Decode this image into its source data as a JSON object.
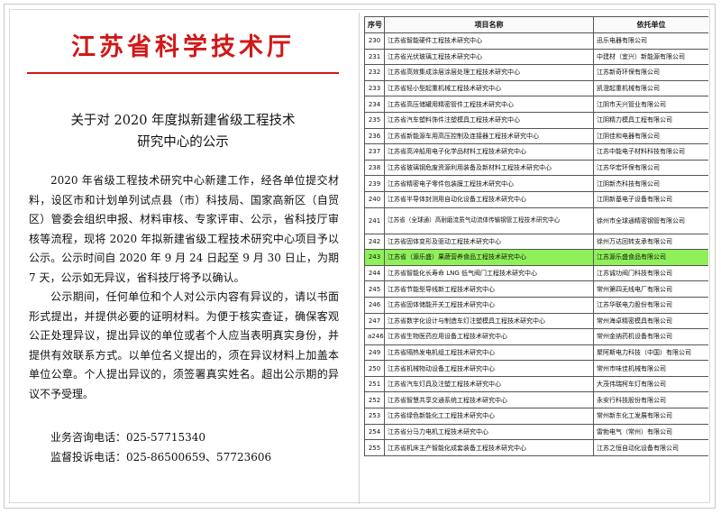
{
  "notice": {
    "masthead": "江苏省科学技术厅",
    "title_line1": "关于对 2020 年度拟新建省级工程技术",
    "title_line2": "研究中心的公示",
    "paragraph1": "2020 年省级工程技术研究中心新建工作，经各单位提交材料，设区市和计划单列试点县（市）科技局、国家高新区（自贸区）管委会组织申报、材料审核、专家评审、公示，省科技厅审核等流程，现将 2020 年拟新建省级工程技术研究中心项目予以公示。公示时间自 2020 年 9 月 24 日起至 9 月 30 日止，为期 7 天，公示如无异议，省科技厅将予以确认。",
    "paragraph2": "公示期间，任何单位和个人对公示内容有异议的，请以书面形式提出，并提供必要的证明材料。为便于核实查证，确保客观公正处理异议，提出异议的单位或者个人应当表明真实身份，并提供有效联系方式。以单位名义提出的，须在异议材料上加盖本单位公章。个人提出异议的，须签署真实姓名。超出公示期的异议不予受理。",
    "consult_label": "业务咨询电话：",
    "consult_phone": "025-57715340",
    "supervise_label": "监督投诉电话：",
    "supervise_phone": "025-86500659、57723606"
  },
  "table": {
    "headers": {
      "no": "序号",
      "name": "项目名称",
      "unit": "依托单位"
    },
    "rows": [
      {
        "no": "230",
        "name": "江苏省智能硬件工程技术研究中心",
        "unit": "迅乐电器有限公司"
      },
      {
        "no": "231",
        "name": "江苏省光伏玻璃工程技术研究中心",
        "unit": "中建材（宜兴）新能源有限公司"
      },
      {
        "no": "232",
        "name": "江苏省高效集成涂层涂层处理工程技术研究中心",
        "unit": "江苏新奇环保有限公司"
      },
      {
        "no": "233",
        "name": "江苏省轻小型起重机械工程技术研究中心",
        "unit": "凯澄起重机械有限公司"
      },
      {
        "no": "234",
        "name": "江苏省高压储罐用精密管件工程技术研究中心",
        "unit": "江阴市天兴管业有限公司"
      },
      {
        "no": "235",
        "name": "江苏省汽车塑料饰件注塑模具工程技术研究中心",
        "unit": "江阴精力模具工程有限公司"
      },
      {
        "no": "236",
        "name": "江苏省新能源车用高压控制及连接器工程技术研究中心",
        "unit": "江阴佳和电器有限公司"
      },
      {
        "no": "237",
        "name": "江苏省高淬船用电子化学品材料工程技术研究中心",
        "unit": "江苏中能电子材料科技有限公司"
      },
      {
        "no": "238",
        "name": "江苏省玻璃钢危废资源利用装备及新材料工程技术研究中心",
        "unit": "江苏华宏环保有限公司"
      },
      {
        "no": "239",
        "name": "江苏省精密电子零件包装膜工程技术研究中心",
        "unit": "江阴新杰科技有限公司"
      },
      {
        "no": "240",
        "name": "江苏省半导体封测用自动化设备工程技术研究中心",
        "unit": "江阴新基电子设备有限公司"
      },
      {
        "no": "241",
        "name": "江苏省（全球通）高耐磨流质气动流体传输钢管工程技术研究中心",
        "unit": "徐州市全球通精密钢管有限公司",
        "tall": true
      },
      {
        "no": "242",
        "name": "江苏省固体变形及驱动工程技术研究中心",
        "unit": "徐州万达回转支承有限公司"
      },
      {
        "no": "243",
        "name": "江苏省（源乐盛）果蔬营养食品工程技术研究中心",
        "unit": "江苏源乐盛食品有限公司",
        "highlight": true
      },
      {
        "no": "244",
        "name": "江苏省智能化长寿命 LNG 低气阀门工程技术研究中心",
        "unit": "江苏诚功阀门科技有限公司"
      },
      {
        "no": "245",
        "name": "江苏省节能型导线新工程技术研究中心",
        "unit": "常州第四无线电厂有限公司"
      },
      {
        "no": "246",
        "name": "江苏省固体储能开关工程技术研究中心",
        "unit": "江苏华联电力股份有限公司"
      },
      {
        "no": "247",
        "name": "江苏省数字化设计与制造车灯注塑模具工程技术研究中心",
        "unit": "常州海卓精密模具有限公司"
      },
      {
        "no": "a246",
        "name": "江苏省生物医药应用设备工程技术研究中心",
        "unit": "常州金纳药机设备有限公司"
      },
      {
        "no": "249",
        "name": "江苏省隔热发电机组工程技术研究中心",
        "unit": "聚阿斯电力科技（中国）有限公司"
      },
      {
        "no": "250",
        "name": "江苏省机械物动设备工程技术研究中心",
        "unit": "常州市味佳机械有限公司"
      },
      {
        "no": "251",
        "name": "江苏省汽车灯具及注塑工程技术研究中心",
        "unit": "大茂伟瑞柯车灯有限公司"
      },
      {
        "no": "252",
        "name": "江苏省智慧共享交通系统工程技术研究中心",
        "unit": "永安行科技股份有限公司"
      },
      {
        "no": "253",
        "name": "江苏省绿色新能化工工程技术研究中心",
        "unit": "常州新东化工发展有限公司"
      },
      {
        "no": "254",
        "name": "江苏省分马力电机工程技术研究中心",
        "unit": "雷勃电气（常州）有限公司"
      },
      {
        "no": "255",
        "name": "江苏省机床主产智能化成套装备工程技术研究中心",
        "unit": "江苏之恒自动化设备有限公司"
      }
    ]
  }
}
